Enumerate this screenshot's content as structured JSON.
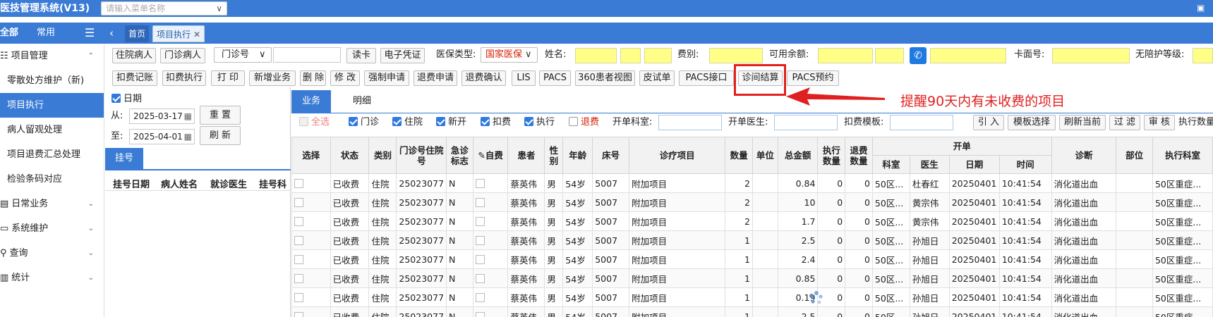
{
  "app": {
    "title": "医技管理系统(V13)",
    "menu_search_placeholder": "请输入菜单名称"
  },
  "nav": {
    "all": "全部",
    "common": "常用"
  },
  "page_tabs": {
    "home": "首页",
    "exec": "项目执行"
  },
  "sidebar": {
    "group_project": "项目管理",
    "items": [
      "零散处方维护（新)",
      "项目执行",
      "病人留观处理",
      "项目退费汇总处理",
      "检验条码对应"
    ],
    "group_daily": "日常业务",
    "group_system": "系统维护",
    "group_query": "查询",
    "group_stats": "统计"
  },
  "toolbar1": {
    "inpatient": "住院病人",
    "outpatient": "门诊病人",
    "clinic_no": "门诊号",
    "read_card": "读卡",
    "e_cert": "电子凭证",
    "insurance_type_label": "医保类型:",
    "insurance_type_value": "国家医保",
    "name_label": "姓名:",
    "fee_label": "费别:",
    "balance_label": "可用余额:",
    "card_label": "卡面号:",
    "no_care_label": "无陪护等级:"
  },
  "toolbar2": [
    "扣费记账",
    "扣费执行",
    "打 印",
    "新增业务",
    "删 除",
    "修 改",
    "强制申请",
    "退费申请",
    "退费确认",
    "LIS",
    "PACS",
    "360患者视图",
    "皮试单",
    "PACS接口",
    "诊间结算",
    "PACS预约"
  ],
  "filter": {
    "date_label": "日期",
    "from_label": "从:",
    "from_value": "2025-03-17",
    "to_label": "至:",
    "to_value": "2025-04-01",
    "reset": "重 置",
    "refresh": "刷 新"
  },
  "left_tab": {
    "register": "挂号"
  },
  "left_cols": [
    "挂号日期",
    "病人姓名",
    "就诊医生",
    "挂号科"
  ],
  "right_tabs": {
    "business": "业务",
    "detail": "明细"
  },
  "filter_bar": {
    "select_all": "全选",
    "outpatient": "门诊",
    "inpatient": "住院",
    "new_open": "新开",
    "deduct": "扣费",
    "execute": "执行",
    "refund": "退费",
    "dept_label": "开单科室:",
    "doctor_label": "开单医生:",
    "template_label": "扣费模板:",
    "btn_import": "引 入",
    "btn_template": "模板选择",
    "btn_refresh_current": "刷新当前",
    "btn_filter": "过 滤",
    "btn_audit": "审 核",
    "exec_count_label": "执行数量"
  },
  "grid": {
    "headers": {
      "select": "选择",
      "status": "状态",
      "category": "类别",
      "no": "门诊号住院号",
      "urgent": "急诊标志",
      "self_pay": "自费",
      "patient": "患者",
      "sex": "性别",
      "age": "年龄",
      "bed": "床号",
      "item": "诊疗项目",
      "qty": "数量",
      "unit": "单位",
      "total": "总金额",
      "exec_qty": "执行数量",
      "refund_qty": "退费数量",
      "order_group": "开单",
      "dept": "科室",
      "doctor": "医生",
      "date": "日期",
      "time": "时间",
      "diag": "诊断",
      "part": "部位",
      "exec_dept": "执行科室"
    },
    "rows": [
      {
        "status": "已收费",
        "category": "住院",
        "no": "25023077",
        "urgent": "N",
        "patient": "蔡英伟",
        "sex": "男",
        "age": "54岁",
        "bed": "5007",
        "item": "附加项目",
        "qty": "2",
        "total": "0.84",
        "exec_qty": "0",
        "refund_qty": "0",
        "dept": "50区...",
        "doctor": "杜春红",
        "date": "20250401",
        "time": "10:41:54",
        "diag": "消化道出血",
        "exec_dept": "50区重症..."
      },
      {
        "status": "已收费",
        "category": "住院",
        "no": "25023077",
        "urgent": "N",
        "patient": "蔡英伟",
        "sex": "男",
        "age": "54岁",
        "bed": "5007",
        "item": "附加项目",
        "qty": "2",
        "total": "10",
        "exec_qty": "0",
        "refund_qty": "0",
        "dept": "50区...",
        "doctor": "黄宗伟",
        "date": "20250401",
        "time": "10:41:54",
        "diag": "消化道出血",
        "exec_dept": "50区重症..."
      },
      {
        "status": "已收费",
        "category": "住院",
        "no": "25023077",
        "urgent": "N",
        "patient": "蔡英伟",
        "sex": "男",
        "age": "54岁",
        "bed": "5007",
        "item": "附加项目",
        "qty": "2",
        "total": "1.7",
        "exec_qty": "0",
        "refund_qty": "0",
        "dept": "50区...",
        "doctor": "黄宗伟",
        "date": "20250401",
        "time": "10:41:54",
        "diag": "消化道出血",
        "exec_dept": "50区重症..."
      },
      {
        "status": "已收费",
        "category": "住院",
        "no": "25023077",
        "urgent": "N",
        "patient": "蔡英伟",
        "sex": "男",
        "age": "54岁",
        "bed": "5007",
        "item": "附加项目",
        "qty": "1",
        "total": "2.5",
        "exec_qty": "0",
        "refund_qty": "0",
        "dept": "50区...",
        "doctor": "孙旭日",
        "date": "20250401",
        "time": "10:41:54",
        "diag": "消化道出血",
        "exec_dept": "50区重症..."
      },
      {
        "status": "已收费",
        "category": "住院",
        "no": "25023077",
        "urgent": "N",
        "patient": "蔡英伟",
        "sex": "男",
        "age": "54岁",
        "bed": "5007",
        "item": "附加项目",
        "qty": "1",
        "total": "2.4",
        "exec_qty": "0",
        "refund_qty": "0",
        "dept": "50区...",
        "doctor": "孙旭日",
        "date": "20250401",
        "time": "10:41:54",
        "diag": "消化道出血",
        "exec_dept": "50区重症..."
      },
      {
        "status": "已收费",
        "category": "住院",
        "no": "25023077",
        "urgent": "N",
        "patient": "蔡英伟",
        "sex": "男",
        "age": "54岁",
        "bed": "5007",
        "item": "附加项目",
        "qty": "1",
        "total": "0.85",
        "exec_qty": "0",
        "refund_qty": "0",
        "dept": "50区...",
        "doctor": "孙旭日",
        "date": "20250401",
        "time": "10:41:54",
        "diag": "消化道出血",
        "exec_dept": "50区重症..."
      },
      {
        "status": "已收费",
        "category": "住院",
        "no": "25023077",
        "urgent": "N",
        "patient": "蔡英伟",
        "sex": "男",
        "age": "54岁",
        "bed": "5007",
        "item": "附加项目",
        "qty": "1",
        "total": "0.19",
        "exec_qty": "0",
        "refund_qty": "0",
        "dept": "50区...",
        "doctor": "孙旭日",
        "date": "20250401",
        "time": "10:41:54",
        "diag": "消化道出血",
        "exec_dept": "50区重症..."
      },
      {
        "status": "已收费",
        "category": "住院",
        "no": "25023077",
        "urgent": "N",
        "patient": "蔡英伟",
        "sex": "男",
        "age": "54岁",
        "bed": "5007",
        "item": "附加项目",
        "qty": "1",
        "total": "2.5",
        "exec_qty": "0",
        "refund_qty": "0",
        "dept": "50区...",
        "doctor": "孙旭日",
        "date": "20250401",
        "time": "10:41:54",
        "diag": "消化道出血",
        "exec_dept": "50区重症..."
      }
    ]
  },
  "annotation": {
    "text": "提醒90天内有未收费的项目"
  },
  "colors": {
    "primary": "#3a7bd5",
    "highlight_red": "#e02020",
    "yellow_field": "#ffff88"
  }
}
